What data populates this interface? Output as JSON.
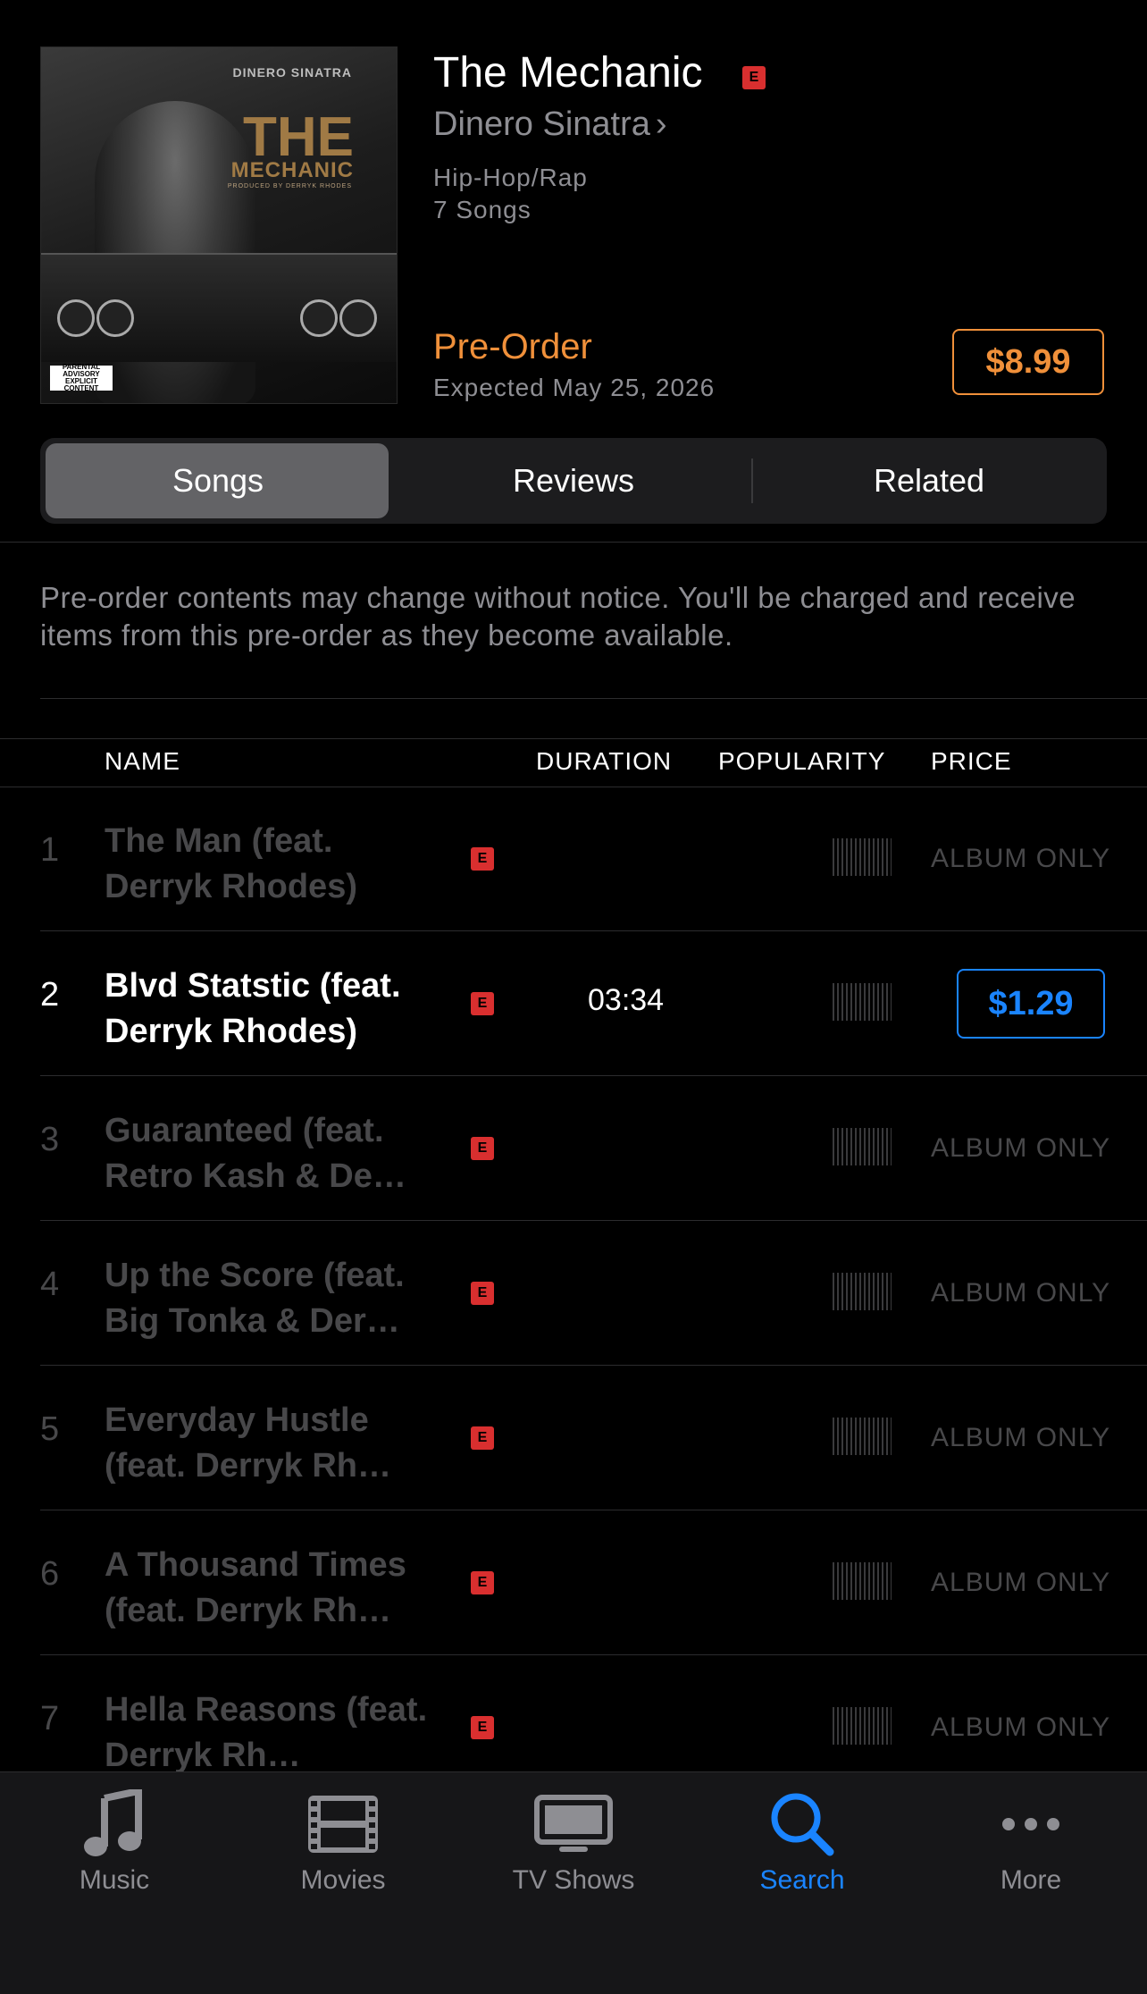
{
  "album": {
    "title": "The Mechanic",
    "explicit_badge": "E",
    "artist": "Dinero Sinatra",
    "artist_chevron": "›",
    "genre": "Hip-Hop/Rap",
    "song_count": "7 Songs",
    "preorder_label": "Pre-Order",
    "expected": "Expected May 25, 2026",
    "price": "$8.99",
    "artwork": {
      "artist_text": "DINERO SINATRA",
      "title_line1": "THE",
      "title_line2": "MECHANIC",
      "producer_text": "PRODUCED BY DERRYK RHODES",
      "advisory_text": "PARENTAL ADVISORY EXPLICIT CONTENT"
    }
  },
  "segments": [
    "Songs",
    "Reviews",
    "Related"
  ],
  "selected_segment": "Songs",
  "notice": "Pre-order contents may change without notice. You'll be charged and receive items from this pre-order as they become available.",
  "table": {
    "headers": {
      "name": "NAME",
      "duration": "DURATION",
      "popularity": "POPULARITY",
      "price": "PRICE"
    },
    "rows": [
      {
        "num": "1",
        "name": "The Man (feat. Derryk Rhodes)",
        "explicit": "E",
        "duration": "",
        "price": "ALBUM ONLY",
        "available": false
      },
      {
        "num": "2",
        "name": "Blvd Statstic (feat. Derryk Rhodes)",
        "explicit": "E",
        "duration": "03:34",
        "price": "$1.29",
        "available": true
      },
      {
        "num": "3",
        "name": "Guaranteed (feat. Retro Kash & De…",
        "explicit": "E",
        "duration": "",
        "price": "ALBUM ONLY",
        "available": false
      },
      {
        "num": "4",
        "name": "Up the Score (feat. Big Tonka & Der…",
        "explicit": "E",
        "duration": "",
        "price": "ALBUM ONLY",
        "available": false
      },
      {
        "num": "5",
        "name": "Everyday Hustle (feat. Derryk Rh…",
        "explicit": "E",
        "duration": "",
        "price": "ALBUM ONLY",
        "available": false
      },
      {
        "num": "6",
        "name": "A Thousand Times (feat. Derryk Rh…",
        "explicit": "E",
        "duration": "",
        "price": "ALBUM ONLY",
        "available": false
      },
      {
        "num": "7",
        "name": "Hella Reasons (feat. Derryk Rh…",
        "explicit": "E",
        "duration": "",
        "price": "ALBUM ONLY",
        "available": false
      }
    ]
  },
  "tabbar": {
    "items": [
      {
        "label": "Music",
        "icon": "music-note-icon"
      },
      {
        "label": "Movies",
        "icon": "film-icon"
      },
      {
        "label": "TV Shows",
        "icon": "tv-icon"
      },
      {
        "label": "Search",
        "icon": "search-icon"
      },
      {
        "label": "More",
        "icon": "more-dots-icon"
      }
    ],
    "active": "Search"
  },
  "colors": {
    "accent_blue": "#1a84ff",
    "preorder_orange": "#f0903a",
    "explicit_red": "#d92f2f",
    "background": "#000000"
  }
}
